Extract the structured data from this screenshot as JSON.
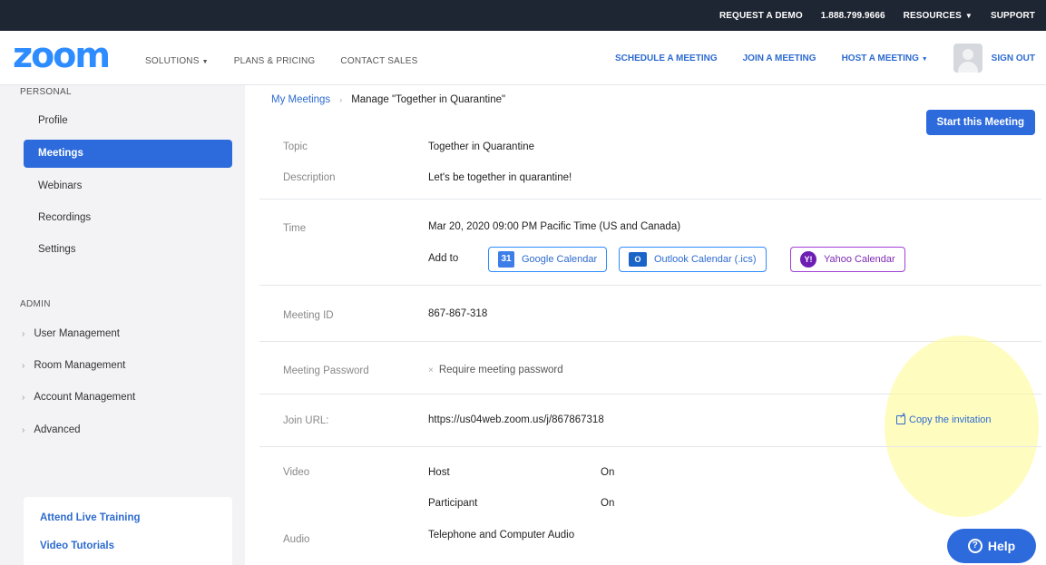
{
  "topbar": {
    "request_demo": "REQUEST A DEMO",
    "phone": "1.888.799.9666",
    "resources": "RESOURCES",
    "support": "SUPPORT"
  },
  "navbar": {
    "logo": "zoom",
    "solutions": "SOLUTIONS",
    "plans": "PLANS & PRICING",
    "contact": "CONTACT SALES",
    "schedule": "SCHEDULE A MEETING",
    "join": "JOIN A MEETING",
    "host": "HOST A MEETING",
    "signout": "SIGN OUT"
  },
  "sidebar": {
    "personal_heading": "PERSONAL",
    "personal_items": [
      "Profile",
      "Meetings",
      "Webinars",
      "Recordings",
      "Settings"
    ],
    "active_item": "Meetings",
    "admin_heading": "ADMIN",
    "admin_items": [
      "User Management",
      "Room Management",
      "Account Management",
      "Advanced"
    ],
    "bottom_links": [
      "Attend Live Training",
      "Video Tutorials"
    ]
  },
  "breadcrumb": {
    "parent": "My Meetings",
    "current": "Manage \"Together in Quarantine\""
  },
  "start_button": "Start this Meeting",
  "meeting": {
    "topic_label": "Topic",
    "topic": "Together in Quarantine",
    "description_label": "Description",
    "description": "Let's be together in quarantine!",
    "time_label": "Time",
    "time": "Mar 20, 2020 09:00 PM Pacific Time (US and Canada)",
    "add_to_label": "Add to",
    "calendars": {
      "google": "Google Calendar",
      "outlook": "Outlook Calendar (.ics)",
      "yahoo": "Yahoo Calendar"
    },
    "id_label": "Meeting ID",
    "id": "867-867-318",
    "password_label": "Meeting Password",
    "password": "Require meeting password",
    "join_label": "Join URL:",
    "join_url": "https://us04web.zoom.us/j/867867318",
    "copy_invitation": "Copy the invitation",
    "video_label": "Video",
    "host_label": "Host",
    "host_value": "On",
    "participant_label": "Participant",
    "participant_value": "On",
    "audio_label": "Audio",
    "audio": "Telephone and Computer Audio"
  },
  "help": "Help",
  "colors": {
    "accent": "#2d6bdc",
    "brand": "#2d8cff",
    "topbar_bg": "#1f2633"
  }
}
